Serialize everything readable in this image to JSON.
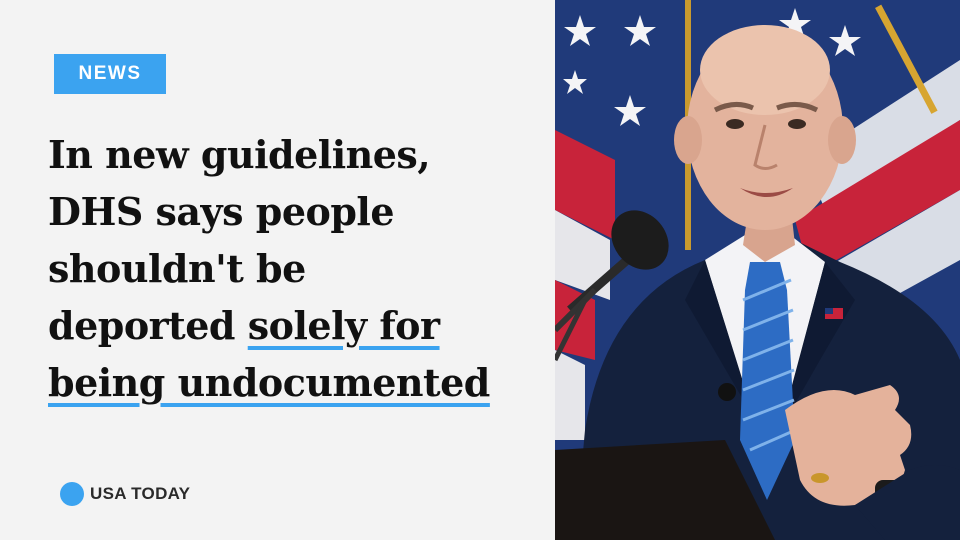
{
  "badge": {
    "label": "NEWS"
  },
  "headline": {
    "line1": "In new guidelines,",
    "line2": "DHS says people",
    "line3": "shouldn't be",
    "line4_plain": "deported ",
    "line4_highlight": "solely for",
    "line5_highlight": "being undocumented"
  },
  "brand": {
    "name": "USA TODAY"
  },
  "colors": {
    "accent": "#3ba3f0",
    "background": "#f3f3f3",
    "headline": "#111111"
  },
  "photo": {
    "subject": "speaker-at-podium-with-flag"
  }
}
